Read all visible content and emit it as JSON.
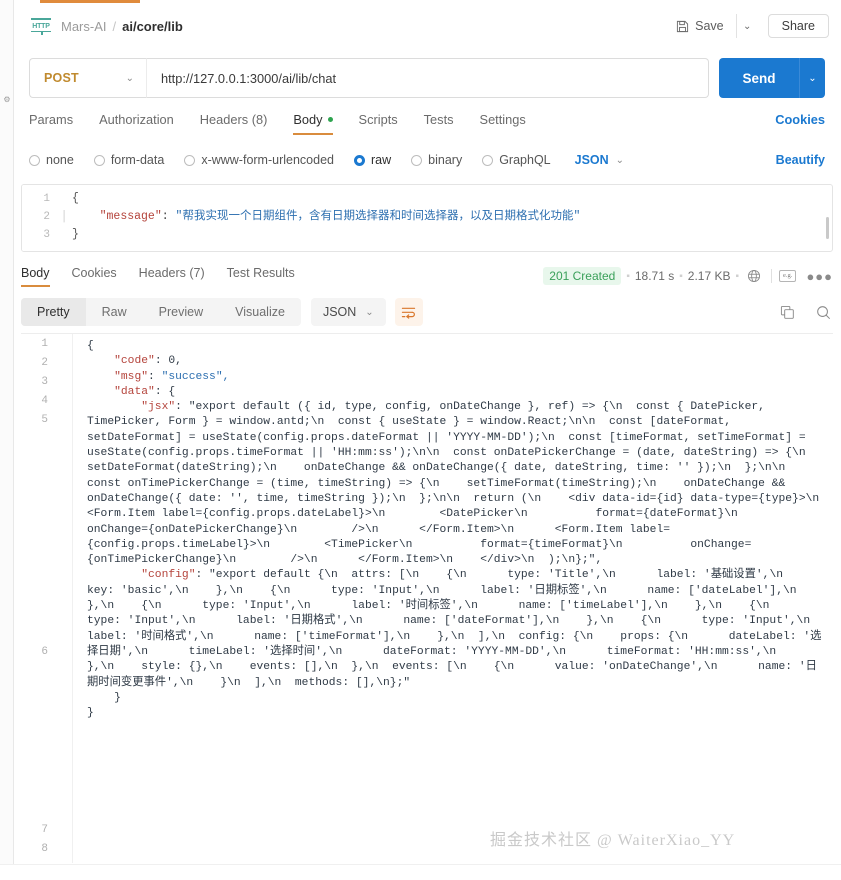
{
  "window": {
    "accent_orange": "#d98c3d",
    "accent_blue": "#1b79d0",
    "status_green": "#3aa05a"
  },
  "header": {
    "protocol_icon_label": "HTTP",
    "collection": "Mars-AI",
    "separator": "/",
    "request_name": "ai/core/lib",
    "save_label": "Save",
    "save_caret": "⌄",
    "share_label": "Share"
  },
  "urlbar": {
    "method": "POST",
    "method_caret": "⌄",
    "url": "http://127.0.0.1:3000/ai/lib/chat",
    "send_label": "Send",
    "send_caret": "⌄"
  },
  "request_tabs": {
    "items": [
      {
        "label": "Params",
        "active": false
      },
      {
        "label": "Authorization",
        "active": false
      },
      {
        "label": "Headers (8)",
        "active": false
      },
      {
        "label": "Body",
        "active": true
      },
      {
        "label": "Scripts",
        "active": false
      },
      {
        "label": "Tests",
        "active": false
      },
      {
        "label": "Settings",
        "active": false
      }
    ],
    "cookies_link": "Cookies"
  },
  "body_types": {
    "options": [
      {
        "label": "none",
        "selected": false
      },
      {
        "label": "form-data",
        "selected": false
      },
      {
        "label": "x-www-form-urlencoded",
        "selected": false
      },
      {
        "label": "raw",
        "selected": true
      },
      {
        "label": "binary",
        "selected": false
      },
      {
        "label": "GraphQL",
        "selected": false
      }
    ],
    "format": "JSON",
    "format_caret": "⌄",
    "beautify_label": "Beautify"
  },
  "request_editor": {
    "line_numbers": [
      "1",
      "2",
      "3"
    ],
    "line1": "{",
    "line2_key": "\"message\"",
    "line2_colon": ":",
    "line2_value": "\"帮我实现一个日期组件，含有日期选择器和时间选择器，以及日期格式化功能\"",
    "line3": "}"
  },
  "response_tabs": {
    "items": [
      {
        "label": "Body",
        "active": true
      },
      {
        "label": "Cookies",
        "active": false
      },
      {
        "label": "Headers (7)",
        "active": false
      },
      {
        "label": "Test Results",
        "active": false
      }
    ],
    "status_code": "201 Created",
    "time": "18.71 s",
    "size": "2.17 KB",
    "globe_icon": "globe-icon",
    "eg_label": "e.g.",
    "more_label": "○○○"
  },
  "response_toolbar": {
    "views": [
      {
        "label": "Pretty",
        "active": true
      },
      {
        "label": "Raw",
        "active": false
      },
      {
        "label": "Preview",
        "active": false
      },
      {
        "label": "Visualize",
        "active": false
      }
    ],
    "format": "JSON",
    "format_caret": "⌄",
    "wrap_icon": "wrap-lines-icon",
    "copy_icon": "copy-icon",
    "search_icon": "search-icon"
  },
  "response_body": {
    "line_numbers": [
      "1",
      "2",
      "3",
      "4",
      "5",
      "6",
      "7",
      "8"
    ],
    "line1": "{",
    "line2_key": "\"code\"",
    "line2_value": "0,",
    "line3_key": "\"msg\"",
    "line3_value": "\"success\",",
    "line4_key": "\"data\"",
    "line4_value": "{",
    "line5_key": "\"jsx\"",
    "line5_value": "\"export default ({ id, type, config, onDateChange }, ref) => {\\n  const { DatePicker, TimePicker, Form } = window.antd;\\n  const { useState } = window.React;\\n\\n  const [dateFormat, setDateFormat] = useState(config.props.dateFormat || 'YYYY-MM-DD');\\n  const [timeFormat, setTimeFormat] = useState(config.props.timeFormat || 'HH:mm:ss');\\n\\n  const onDatePickerChange = (date, dateString) => {\\n    setDateFormat(dateString);\\n    onDateChange && onDateChange({ date, dateString, time: '' });\\n  };\\n\\n  const onTimePickerChange = (time, timeString) => {\\n    setTimeFormat(timeString);\\n    onDateChange && onDateChange({ date: '', time, timeString });\\n  };\\n\\n  return (\\n    <div data-id={id} data-type={type}>\\n      <Form.Item label={config.props.dateLabel}>\\n        <DatePicker\\n          format={dateFormat}\\n          onChange={onDatePickerChange}\\n        />\\n      </Form.Item>\\n      <Form.Item label={config.props.timeLabel}>\\n        <TimePicker\\n          format={timeFormat}\\n          onChange={onTimePickerChange}\\n        />\\n      </Form.Item>\\n    </div>\\n  );\\n};\",",
    "line6_key": "\"config\"",
    "line6_value": "\"export default {\\n  attrs: [\\n    {\\n      type: 'Title',\\n      label: '基础设置',\\n      key: 'basic',\\n    },\\n    {\\n      type: 'Input',\\n      label: '日期标签',\\n      name: ['dateLabel'],\\n    },\\n    {\\n      type: 'Input',\\n      label: '时间标签',\\n      name: ['timeLabel'],\\n    },\\n    {\\n      type: 'Input',\\n      label: '日期格式',\\n      name: ['dateFormat'],\\n    },\\n    {\\n      type: 'Input',\\n      label: '时间格式',\\n      name: ['timeFormat'],\\n    },\\n  ],\\n  config: {\\n    props: {\\n      dateLabel: '选择日期',\\n      timeLabel: '选择时间',\\n      dateFormat: 'YYYY-MM-DD',\\n      timeFormat: 'HH:mm:ss',\\n    },\\n    style: {},\\n    events: [],\\n  },\\n  events: [\\n    {\\n      value: 'onDateChange',\\n      name: '日期时间变更事件',\\n    }\\n  ],\\n  methods: [],\\n};\"",
    "line7": "}",
    "line8": "}"
  },
  "watermark": {
    "text": "掘金技术社区 @ WaiterXiao_YY"
  }
}
